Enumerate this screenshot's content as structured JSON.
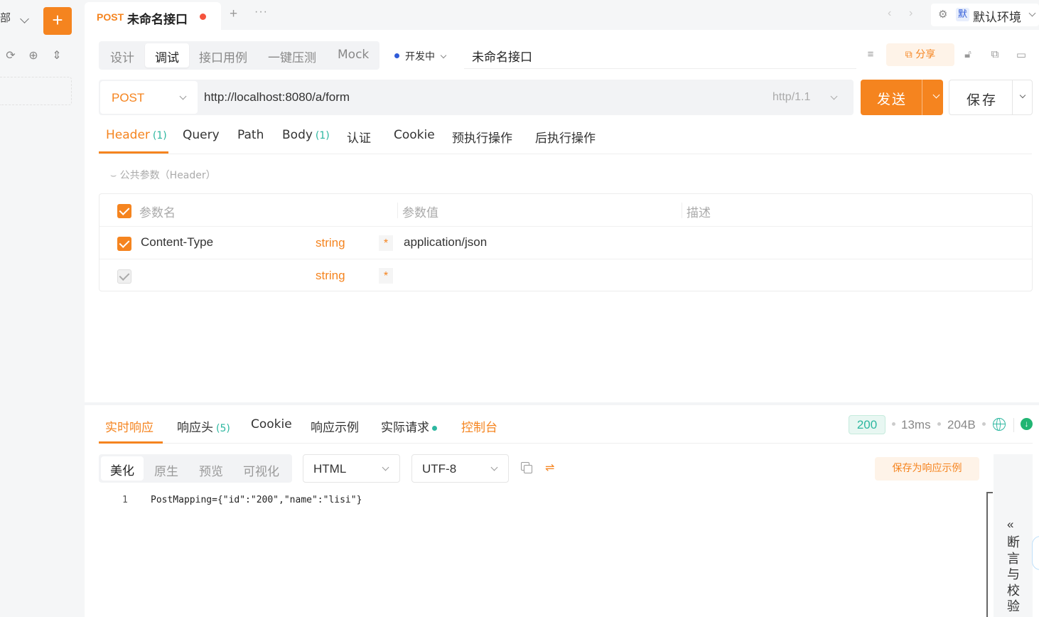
{
  "sidebar": {
    "group_select": "部",
    "icons": [
      "refresh-icon",
      "locate-icon",
      "expand-collapse-icon"
    ]
  },
  "tab": {
    "method": "POST",
    "title": "未命名接口"
  },
  "env": {
    "badge": "默",
    "name": "默认环境"
  },
  "modes": [
    "设计",
    "调试",
    "接口用例",
    "一键压测",
    "Mock"
  ],
  "active_mode": "调试",
  "status": "开发中",
  "api_name": "未命名接口",
  "share_label": "分享",
  "request": {
    "method": "POST",
    "url": "http://localhost:8080/a/form",
    "protocol": "http/1.1"
  },
  "send_label": "发送",
  "save_label": "保存",
  "req_tabs": [
    {
      "label": "Header",
      "count": "(1)"
    },
    {
      "label": "Query",
      "count": ""
    },
    {
      "label": "Path",
      "count": ""
    },
    {
      "label": "Body",
      "count": "(1)"
    },
    {
      "label": "认证",
      "count": ""
    },
    {
      "label": "Cookie",
      "count": ""
    },
    {
      "label": "预执行操作",
      "count": ""
    },
    {
      "label": "后执行操作",
      "count": ""
    }
  ],
  "common_param": "公共参数（Header）",
  "params": {
    "headers": [
      "参数名",
      "参数值",
      "描述"
    ],
    "rows": [
      {
        "name": "Content-Type",
        "type": "string",
        "required": "*",
        "value": "application/json",
        "checked": true
      },
      {
        "name": "",
        "type": "string",
        "required": "*",
        "value": "",
        "checked": false
      }
    ]
  },
  "resp_tabs": [
    {
      "label": "实时响应",
      "count": ""
    },
    {
      "label": "响应头",
      "count": "(5)"
    },
    {
      "label": "Cookie",
      "count": ""
    },
    {
      "label": "响应示例",
      "count": ""
    },
    {
      "label": "实际请求",
      "count": ""
    },
    {
      "label": "控制台",
      "count": ""
    }
  ],
  "resp_meta": {
    "status_code": "200",
    "time": "13ms",
    "size": "204B"
  },
  "formats": [
    "美化",
    "原生",
    "预览",
    "可视化"
  ],
  "view_type": "HTML",
  "encoding": "UTF-8",
  "save_example_label": "保存为响应示例",
  "code": {
    "line_no": "1",
    "text": "PostMapping={\"id\":\"200\",\"name\":\"lisi\"}"
  },
  "side_panel": {
    "label": "断言与校验"
  },
  "colors": {
    "accent": "#f5841f",
    "success": "#2db7a0",
    "status_dot": "#2f5bd8"
  }
}
